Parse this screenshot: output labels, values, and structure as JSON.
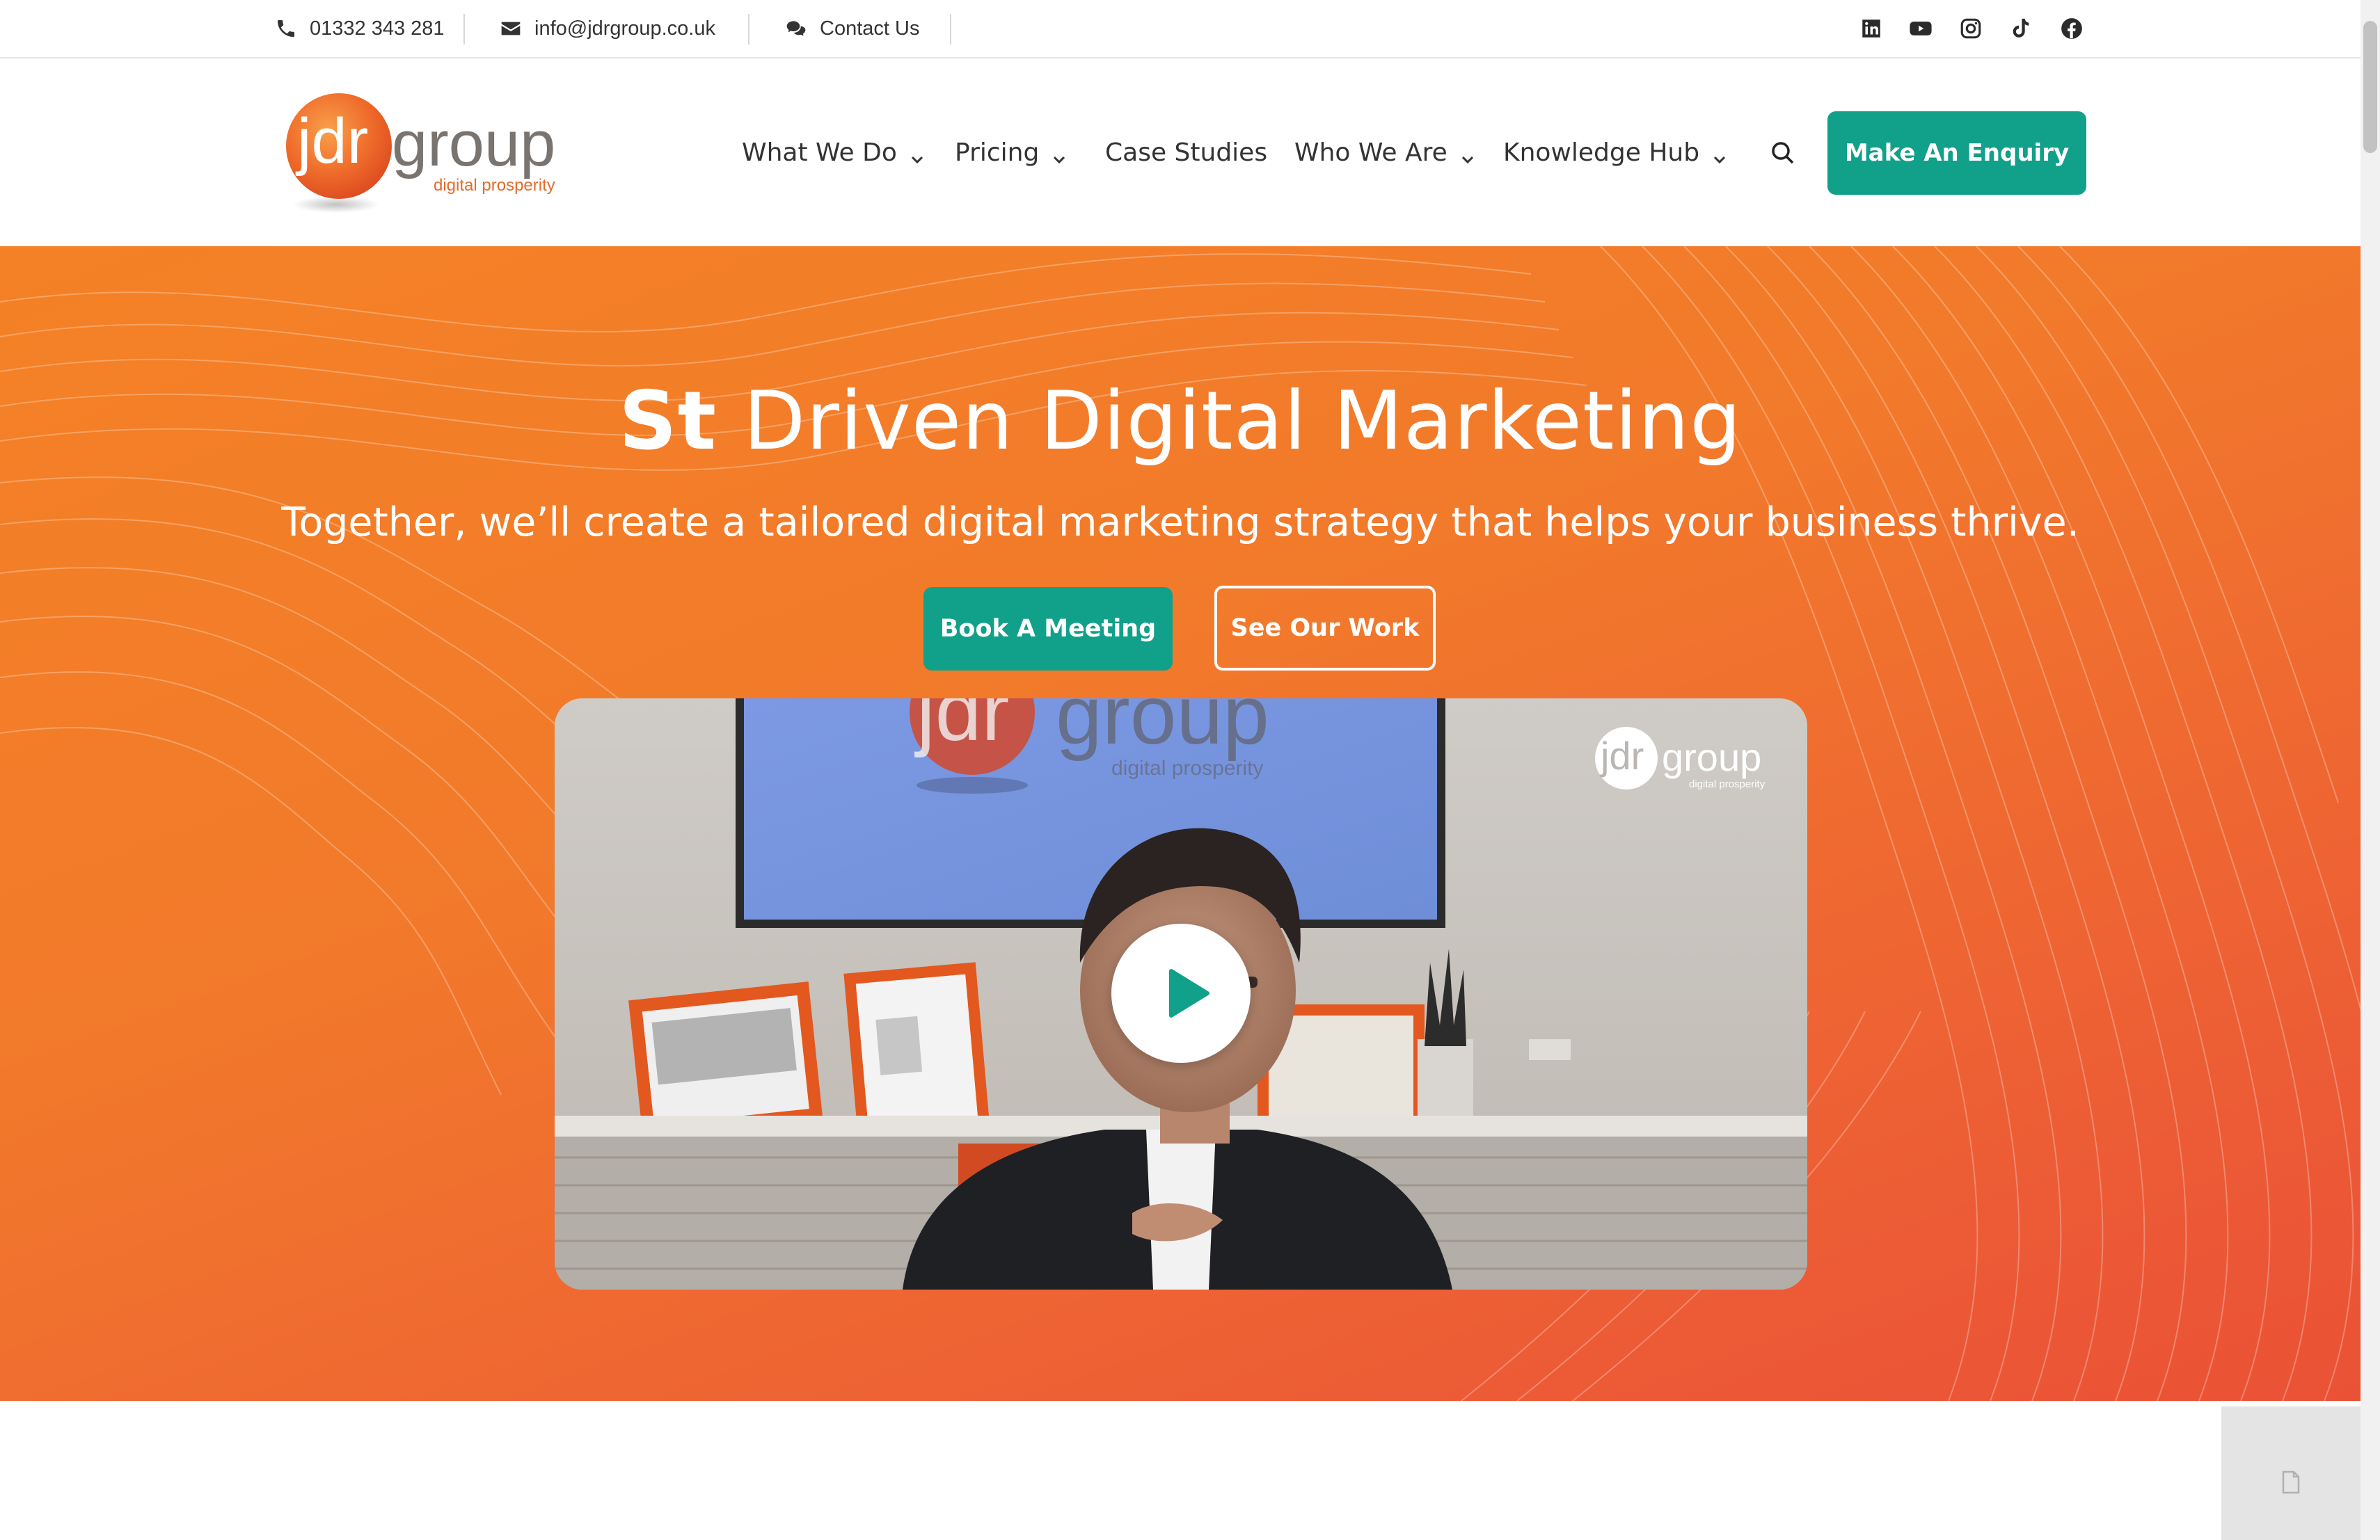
{
  "topbar": {
    "phone": "01332 343 281",
    "email": "info@jdrgroup.co.uk",
    "contact": "Contact Us",
    "social_icons": [
      "linkedin-icon",
      "youtube-icon",
      "instagram-icon",
      "tiktok-icon",
      "facebook-icon"
    ]
  },
  "logo": {
    "brand_left": "jdr",
    "brand_right": "group",
    "tagline": "digital prosperity"
  },
  "nav": {
    "items": [
      {
        "label": "What We Do",
        "dropdown": true
      },
      {
        "label": "Pricing",
        "dropdown": true
      },
      {
        "label": "Case Studies",
        "dropdown": false
      },
      {
        "label": "Who We Are",
        "dropdown": true
      },
      {
        "label": "Knowledge Hub",
        "dropdown": true
      }
    ],
    "search_icon": "search-icon",
    "cta": "Make An Enquiry"
  },
  "hero": {
    "title_bold": "St",
    "title_rest": " Driven Digital Marketing",
    "subtitle": "Together, we’ll create a tailored digital marketing strategy that helps your business thrive.",
    "btn_primary": "Book A Meeting",
    "btn_secondary": "See Our Work",
    "video": {
      "play_icon": "play-icon",
      "overlay_logo_left": "jdr",
      "overlay_logo_right": "group",
      "overlay_logo_tagline": "digital prosperity",
      "wall_logo_left": "jdr",
      "wall_logo_right": "group",
      "wall_logo_tagline": "digital prosperity"
    }
  },
  "colors": {
    "teal": "#11a08a",
    "orange_start": "#f48126",
    "orange_end": "#ea5235",
    "text_dark": "#333333"
  }
}
